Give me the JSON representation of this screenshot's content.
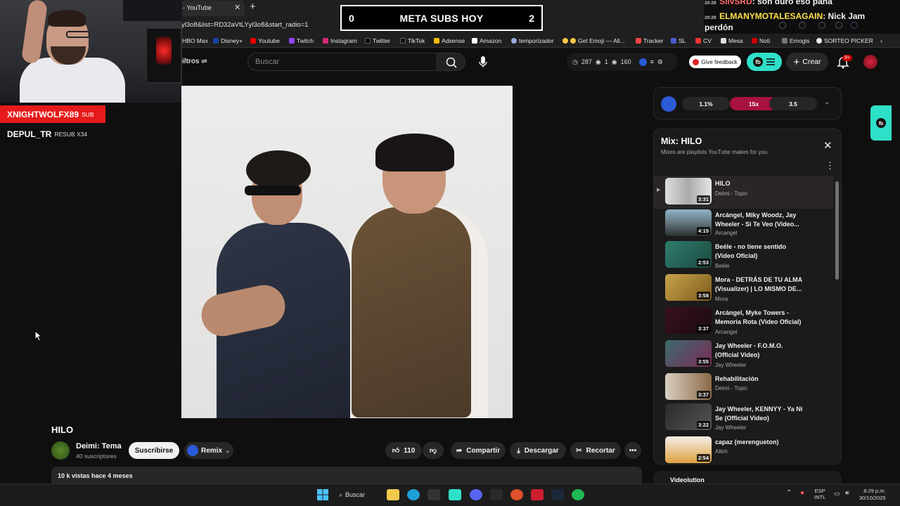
{
  "browser": {
    "tab_title": "- YouTube",
    "new_tab": "+",
    "url": "yl3o8&list=RD32aVtLYyl3o8&start_radio=1",
    "bookmarks": [
      "HBO Max",
      "Disney+",
      "Youtube",
      "Twitch",
      "Instagram",
      "Twitter",
      "TikTok",
      "Adsense",
      "Amazon",
      "temporizador",
      "Get Emoji — All...",
      "Tracker",
      "SL",
      "CV",
      "Mesa",
      "Noti",
      "Emogis",
      "SORTEO PICKER"
    ]
  },
  "overlay": {
    "goal_left": "0",
    "goal_title": "META SUBS HOY",
    "goal_right": "2",
    "chat": [
      {
        "time": "20:29",
        "user": "SilvSRD",
        "text": ": son duro eso pana"
      },
      {
        "time": "20:29",
        "user": "ELMANYMOTALESAGAIN",
        "text": ": Nick Jam"
      },
      {
        "time": "",
        "user": "",
        "text": "perdón"
      }
    ],
    "alert_sub_name": "XNIGHTWOLFX89",
    "alert_sub_tag": "SUB",
    "alert_resub_name": "DEPUL_TR",
    "alert_resub_tag": "RESUB X34"
  },
  "header": {
    "filters_label": "iltros",
    "search_placeholder": "Buscar",
    "stats": [
      "287",
      "1",
      "160"
    ],
    "feedback_label": "Give feedback",
    "create_label": "Crear",
    "notifications_badge": "9+"
  },
  "video": {
    "title": "HILO",
    "channel_name": "Deimi: Tema",
    "channel_subs": "40 suscriptores",
    "subscribe_label": "Suscribirse",
    "remix_label": "Remix",
    "likes": "110",
    "share_label": "Compartir",
    "download_label": "Descargar",
    "clip_label": "Recortar",
    "views_date": "10 k vistas  hace 4 meses"
  },
  "extension": {
    "chips": [
      "1.1%",
      "15x",
      "3.5"
    ]
  },
  "mix": {
    "title": "Mix: HILO",
    "subtitle": "Mixes are playlists YouTube makes for you",
    "items": [
      {
        "title": "HILO",
        "artist": "Deimi - Topic",
        "duration": "3:31"
      },
      {
        "title": "Arcángel, Miky Woodz, Jay Wheeler - Si Te Veo (Video...",
        "artist": "Arcangel",
        "duration": "4:15"
      },
      {
        "title": "Beéle - no tiene sentido (Video Oficial)",
        "artist": "Beéle",
        "duration": "2:53"
      },
      {
        "title": "Mora - DETRÁS DE TU ALMA (Visualizer) | LO MISMO DE...",
        "artist": "Mora",
        "duration": "3:58"
      },
      {
        "title": "Arcángel, Myke Towers - Memoria Rota (Video Oficial)",
        "artist": "Arcangel",
        "duration": "3:37"
      },
      {
        "title": "Jay Wheeler - F.O.M.O. (Official Video)",
        "artist": "Jay Wheeler",
        "duration": "3:55"
      },
      {
        "title": "Rehabilitación",
        "artist": "Deimi - Topic",
        "duration": "3:37"
      },
      {
        "title": "Jay Wheeler, KENNYY - Ya Ni Se (Official Video)",
        "artist": "Jay Wheeler",
        "duration": "3:22"
      },
      {
        "title": "capaz (merengueton)",
        "artist": "Alleh",
        "duration": "2:54"
      }
    ],
    "bottom_card": "Videolution"
  },
  "taskbar": {
    "search_label": "Buscar",
    "lang_1": "ESP",
    "lang_2": "INTL",
    "time": "8:29 p.m.",
    "date": "30/10/2025"
  }
}
